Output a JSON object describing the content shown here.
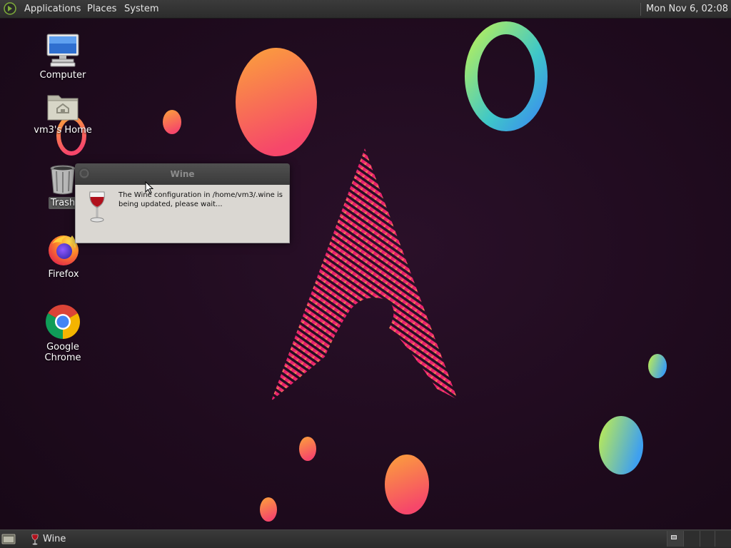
{
  "top_panel": {
    "menus": [
      {
        "label": "Applications"
      },
      {
        "label": "Places"
      },
      {
        "label": "System"
      }
    ],
    "clock": "Mon Nov  6, 02:08"
  },
  "desktop_icons": [
    {
      "label": "Computer",
      "icon": "computer-icon"
    },
    {
      "label": "vm3's Home",
      "icon": "home-folder-icon"
    },
    {
      "label": "Trash",
      "icon": "trash-icon"
    },
    {
      "label": "Firefox",
      "icon": "firefox-icon"
    },
    {
      "label": "Google Chrome",
      "icon": "chrome-icon"
    }
  ],
  "dialog": {
    "title": "Wine",
    "message": "The Wine configuration in /home/vm3/.wine is being updated, please wait...",
    "icon": "wine-glass-icon"
  },
  "bottom_panel": {
    "tasks": [
      {
        "label": "Wine",
        "icon": "wine-glass-icon"
      }
    ],
    "workspaces": 4,
    "active_workspace": 1
  },
  "colors": {
    "background": "#1f0b1e",
    "panel": "#333333",
    "dialog_body": "#dad7d2",
    "arch_logo_top": "#e8186d",
    "arch_logo_bottom": "#f5c23a"
  }
}
